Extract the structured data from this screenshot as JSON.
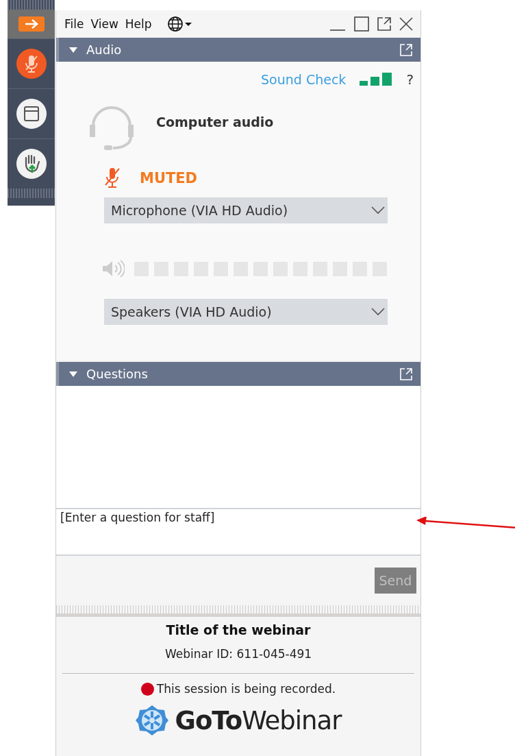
{
  "toolbar": {
    "buttons": [
      {
        "kind": "arrow"
      },
      {
        "kind": "mic"
      },
      {
        "kind": "window"
      },
      {
        "kind": "hand"
      }
    ]
  },
  "menu": [
    "File",
    "View",
    "Help"
  ],
  "audio": {
    "title": "Audio",
    "expanded": true,
    "sound_check": "Sound Check",
    "help": "?",
    "source": "Computer audio",
    "muted": true,
    "muted_label": "MUTED",
    "microphone": "Microphone (VIA HD Audio)",
    "speakers": "Speakers (VIA HD Audio)"
  },
  "questions": {
    "title": "Questions",
    "expanded": true,
    "placeholder": "[Enter a question for staff]",
    "send": "Send",
    "send_disabled": true
  },
  "footer": {
    "title": "Title of the webinar",
    "webinar_id": "Webinar ID: 611-045-491",
    "recording": "This session is being recorded.",
    "recording_on": true,
    "logo": "**GoTo**Webinar"
  }
}
